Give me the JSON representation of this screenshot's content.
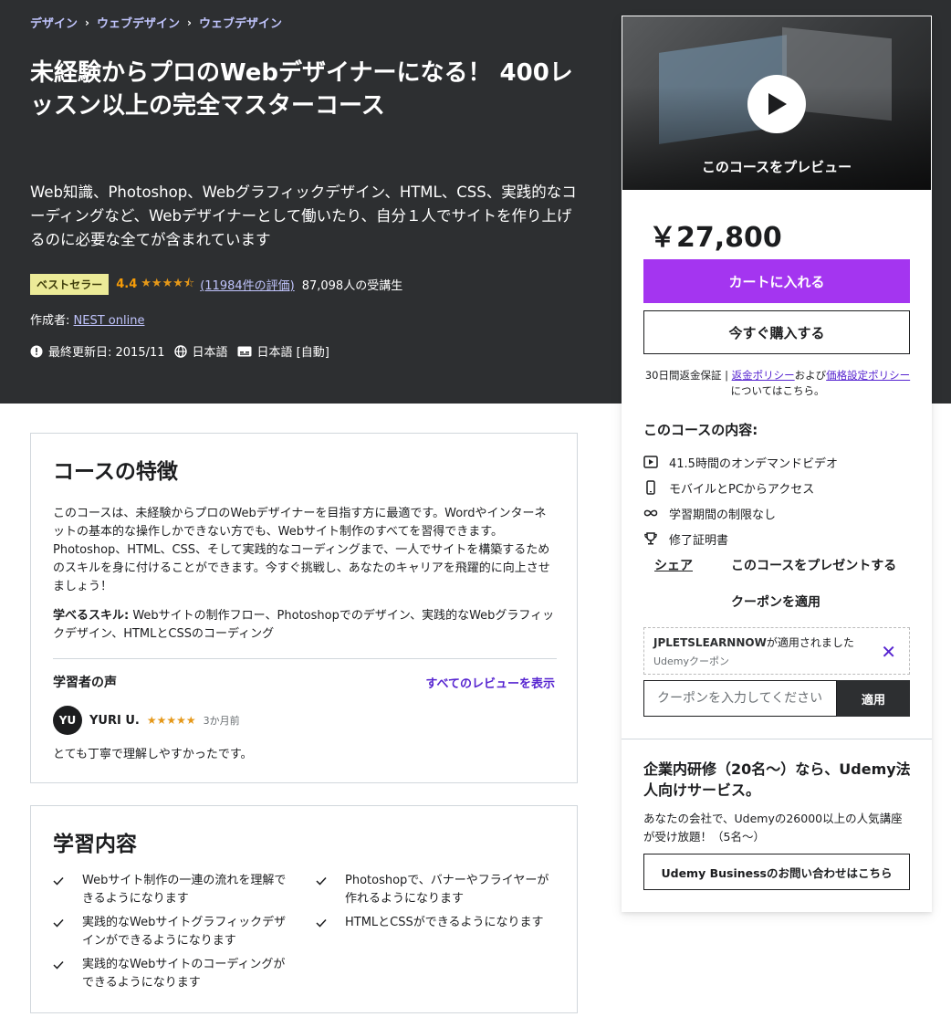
{
  "breadcrumb": [
    "デザイン",
    "ウェブデザイン",
    "ウェブデザイン"
  ],
  "course": {
    "title": "未経験からプロのWebデザイナーになる！ 400レッスン以上の完全マスターコース",
    "subtitle": "Web知識、Photoshop、Webグラフィックデザイン、HTML、CSS、実践的なコーディングなど、Webデザイナーとして働いたり、自分１人でサイトを作り上げるのに必要な全てが含まれています",
    "badge": "ベストセラー",
    "rating": "4.4",
    "rating_value": 4.4,
    "rating_max": 5,
    "reviews_link": "(11984件の評価)",
    "students": "87,098人の受講生",
    "creator_label": "作成者:",
    "creator": "NEST online",
    "last_updated": "最終更新日: 2015/11",
    "language": "日本語",
    "captions": "日本語 [自動]"
  },
  "sidebar": {
    "preview_label": "このコースをプレビュー",
    "price": "￥27,800",
    "cart_button": "カートに入れる",
    "buy_button": "今すぐ購入する",
    "guarantee_prefix": "30日間返金保証 | ",
    "refund_policy": "返金ポリシー",
    "and": "および",
    "pricing_policy": "価格設定ポリシー",
    "guarantee_suffix": "についてはこちら。",
    "includes_title": "このコースの内容:",
    "includes": [
      {
        "icon": "video-icon",
        "label": "41.5時間のオンデマンドビデオ"
      },
      {
        "icon": "mobile-icon",
        "label": "モバイルとPCからアクセス"
      },
      {
        "icon": "infinity-icon",
        "label": "学習期間の制限なし"
      },
      {
        "icon": "trophy-icon",
        "label": "修了証明書"
      }
    ],
    "share": "シェア",
    "gift": "このコースをプレゼントする",
    "apply_coupon": "クーポンを適用",
    "coupon_code": "JPLETSLEARNNOW",
    "coupon_applied": "が適用されました",
    "coupon_sub": "Udemyクーポン",
    "coupon_placeholder": "クーポンを入力してください",
    "coupon_apply_btn": "適用",
    "biz_title": "企業内研修（20名〜）なら、Udemy法人向けサービス。",
    "biz_text": "あなたの会社で、Udemyの26000以上の人気講座が受け放題！（5名〜）",
    "biz_button": "Udemy Businessのお問い合わせはこちら"
  },
  "features": {
    "title": "コースの特徴",
    "description": "このコースは、未経験からプロのWebデザイナーを目指す方に最適です。Wordやインターネットの基本的な操作しかできない方でも、Webサイト制作のすべてを習得できます。Photoshop、HTML、CSS、そして実践的なコーディングまで、一人でサイトを構築するためのスキルを身に付けることができます。今すぐ挑戦し、あなたのキャリアを飛躍的に向上させましょう！",
    "skills_label": "学べるスキル:",
    "skills": " Webサイトの制作フロー、Photoshopでのデザイン、実践的なWebグラフィックデザイン、HTMLとCSSのコーディング",
    "voice_title": "学習者の声",
    "voice_link": "すべてのレビューを表示",
    "reviewer_initials": "YU",
    "reviewer_name": "YURI U.",
    "reviewer_stars": 5,
    "reviewer_time": "3か月前",
    "review_text": "とても丁寧で理解しやすかったです。"
  },
  "learn": {
    "title": "学習内容",
    "items": [
      "Webサイト制作の一連の流れを理解できるようになります",
      "Photoshopで、バナーやフライヤーが作れるようになります",
      "実践的なWebサイトグラフィックデザインができるようになります",
      "HTMLとCSSができるようになります",
      "実践的なWebサイトのコーディングができるようになります"
    ]
  },
  "colors": {
    "hero_bg": "#2d2f31",
    "accent_purple": "#a435f0",
    "link_purple": "#5624d0",
    "star_orange": "#e59819",
    "badge_bg": "#eceb98"
  }
}
